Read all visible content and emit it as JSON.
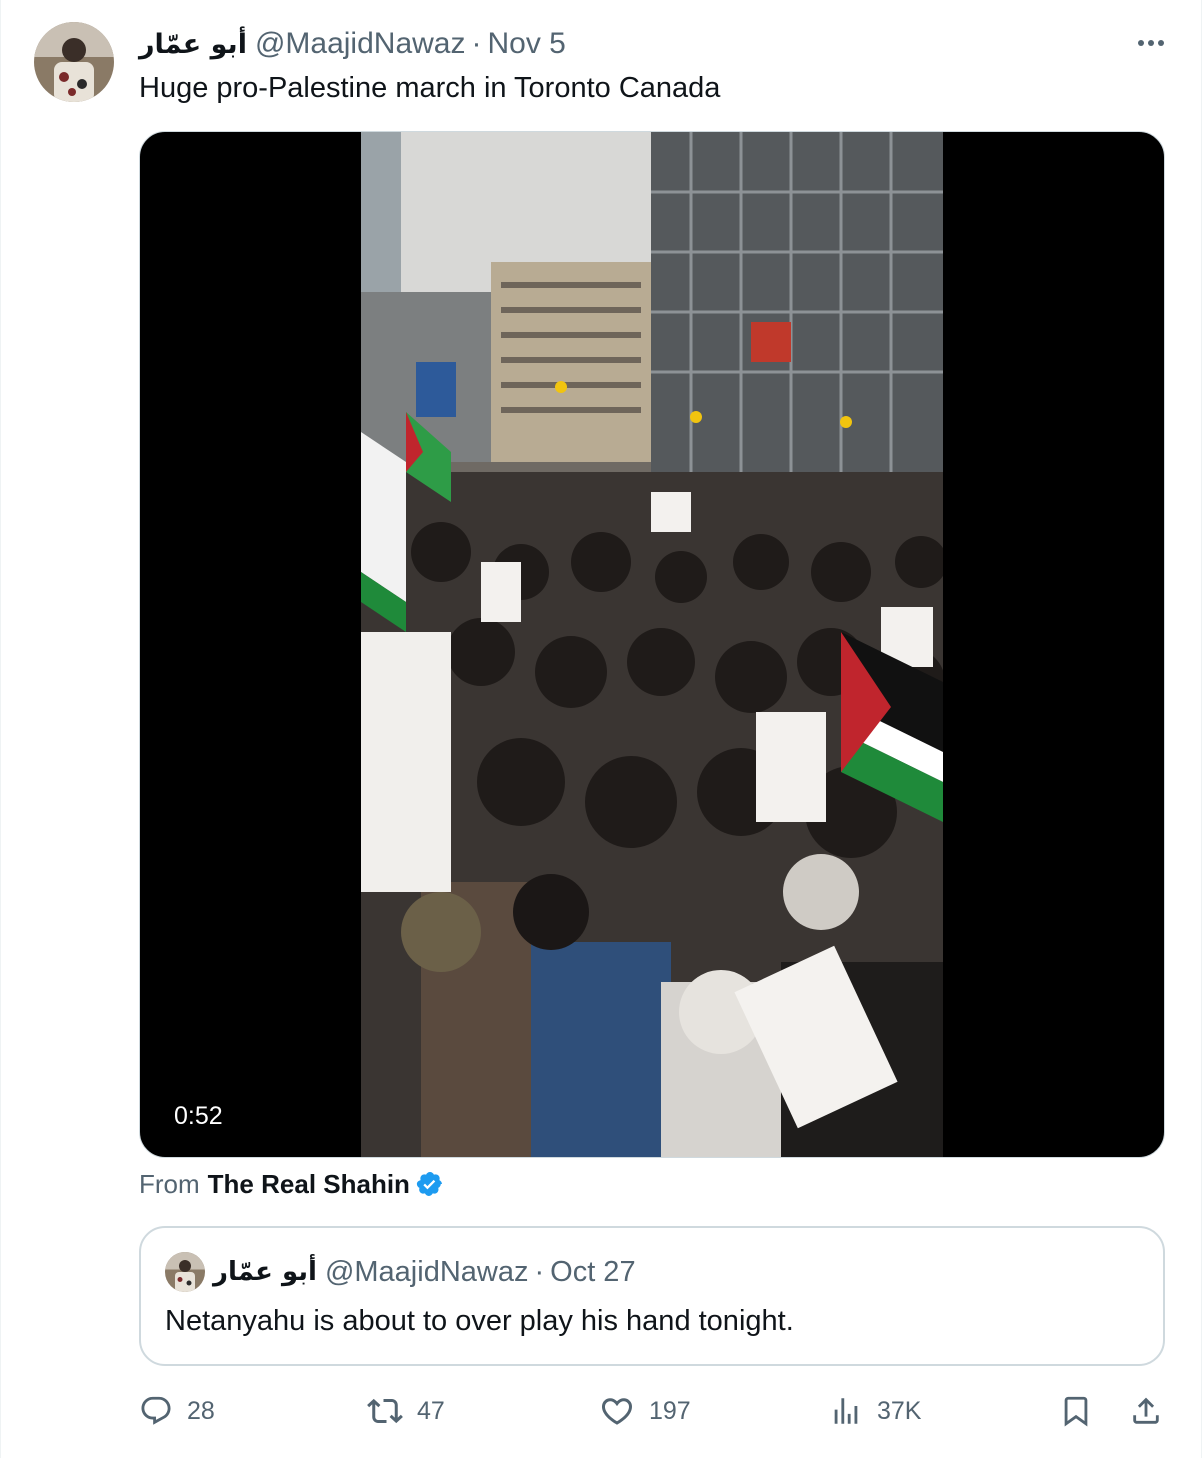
{
  "tweet": {
    "author": {
      "display_name": "أبو عمّار",
      "handle": "@MaajidNawaz"
    },
    "separator": "·",
    "date": "Nov 5",
    "text": "Huge pro-Palestine march in Toronto Canada",
    "media": {
      "duration": "0:52"
    },
    "attribution": {
      "prefix": "From",
      "source": "The Real Shahin"
    }
  },
  "quoted_tweet": {
    "display_name": "أبو عمّار",
    "handle": "@MaajidNawaz",
    "separator": "·",
    "date": "Oct 27",
    "text": "Netanyahu is about to over play his hand tonight."
  },
  "actions": {
    "replies": "28",
    "reposts": "47",
    "likes": "197",
    "views": "37K"
  },
  "icons": [
    "more-icon",
    "verified-icon",
    "reply-icon",
    "repost-icon",
    "like-icon",
    "views-icon",
    "bookmark-icon",
    "share-icon"
  ],
  "colors": {
    "text_primary": "#0f1419",
    "text_secondary": "#536471",
    "border": "#cfd9de",
    "verified_blue": "#1d9bf0"
  }
}
